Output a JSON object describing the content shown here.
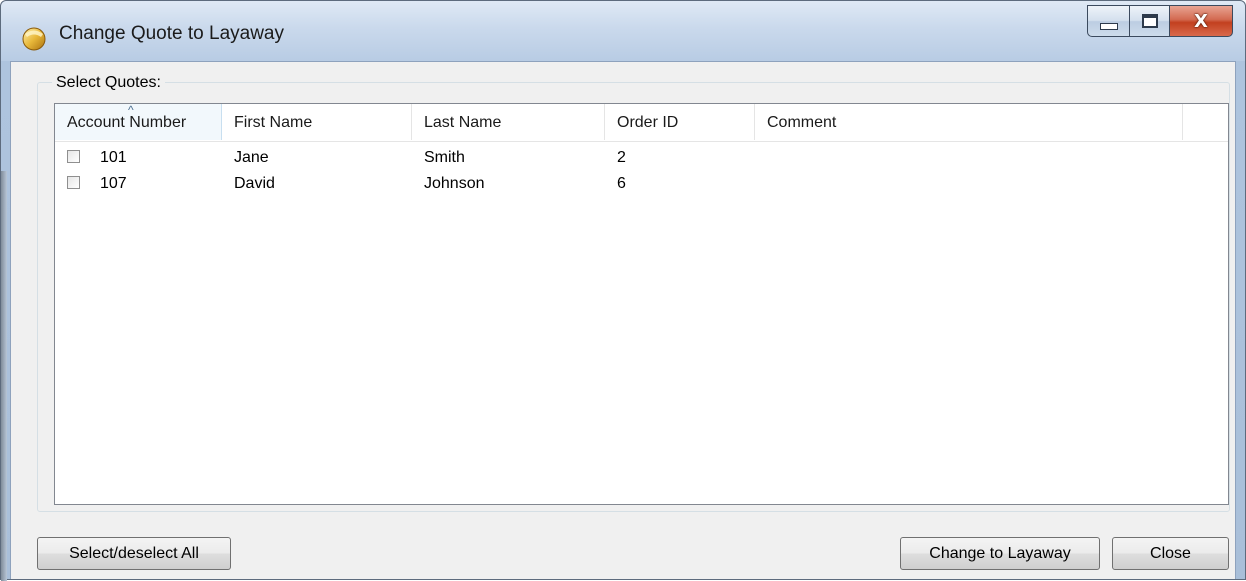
{
  "window": {
    "title": "Change Quote to Layaway",
    "close_glyph": "X"
  },
  "group": {
    "label": "Select Quotes:"
  },
  "list": {
    "sorted_column": "Account Number",
    "sort_indicator": "^",
    "columns": [
      "Account Number",
      "First Name",
      "Last Name",
      "Order ID",
      "Comment"
    ],
    "rows": [
      {
        "checked": false,
        "cells": [
          "101",
          "Jane",
          "Smith",
          "2",
          ""
        ]
      },
      {
        "checked": false,
        "cells": [
          "107",
          "David",
          "Johnson",
          "6",
          ""
        ]
      }
    ]
  },
  "buttons": {
    "select_all": "Select/deselect All",
    "change": "Change to Layaway",
    "close": "Close"
  },
  "icons": {
    "app": "app-icon",
    "minimize": "minimize-icon",
    "maximize": "maximize-icon",
    "close": "close-icon",
    "sort": "sort-ascending-icon"
  }
}
